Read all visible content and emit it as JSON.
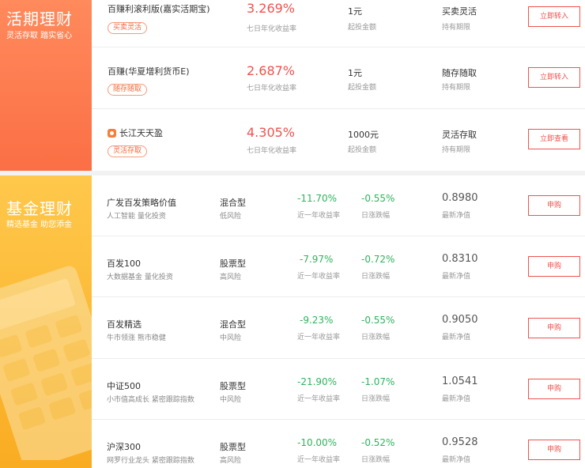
{
  "current_section": {
    "title": "活期理财",
    "subtitle": "灵活存取 踏实省心",
    "products": [
      {
        "name": "百赚利滚利版(嘉实活期宝)",
        "tag": "买卖灵活",
        "rate": "3.269%",
        "rate_label": "七日年化收益率",
        "min_amount": "1元",
        "min_label": "起投金额",
        "hold": "买卖灵活",
        "hold_label": "持有期限",
        "button": "立即转入"
      },
      {
        "name": "百赚(华夏增利货币E)",
        "tag": "随存随取",
        "rate": "2.687%",
        "rate_label": "七日年化收益率",
        "min_amount": "1元",
        "min_label": "起投金额",
        "hold": "随存随取",
        "hold_label": "持有期限",
        "button": "立即转入"
      },
      {
        "name": "长江天天盈",
        "tag": "灵活存取",
        "rate": "4.305%",
        "rate_label": "七日年化收益率",
        "min_amount": "1000元",
        "min_label": "起投金额",
        "hold": "灵活存取",
        "hold_label": "持有期限",
        "button": "立即查看"
      }
    ]
  },
  "fund_section": {
    "title": "基金理财",
    "subtitle": "精选基金 助您添金",
    "funds": [
      {
        "name": "广发百发策略价值",
        "desc": "人工智能  量化投资",
        "type": "混合型",
        "risk": "低风险",
        "year_return": "-11.70%",
        "year_label": "近一年收益率",
        "day_change": "-0.55%",
        "day_label": "日涨跌幅",
        "nav": "0.8980",
        "nav_label": "最新净值",
        "button": "申购"
      },
      {
        "name": "百发100",
        "desc": "大数据基金  量化投资",
        "type": "股票型",
        "risk": "高风险",
        "year_return": "-7.97%",
        "year_label": "近一年收益率",
        "day_change": "-0.72%",
        "day_label": "日涨跌幅",
        "nav": "0.8310",
        "nav_label": "最新净值",
        "button": "申购"
      },
      {
        "name": "百发精选",
        "desc": "牛市领涨  熊市稳健",
        "type": "混合型",
        "risk": "中风险",
        "year_return": "-9.23%",
        "year_label": "近一年收益率",
        "day_change": "-0.55%",
        "day_label": "日涨跌幅",
        "nav": "0.9050",
        "nav_label": "最新净值",
        "button": "申购"
      },
      {
        "name": "中证500",
        "desc": "小市值高成长  紧密跟踪指数",
        "type": "股票型",
        "risk": "中风险",
        "year_return": "-21.90%",
        "year_label": "近一年收益率",
        "day_change": "-1.07%",
        "day_label": "日涨跌幅",
        "nav": "1.0541",
        "nav_label": "最新净值",
        "button": "申购"
      },
      {
        "name": "沪深300",
        "desc": "网罗行业龙头  紧密跟踪指数",
        "type": "股票型",
        "risk": "高风险",
        "year_return": "-10.00%",
        "year_label": "近一年收益率",
        "day_change": "-0.52%",
        "day_label": "日涨跌幅",
        "nav": "0.9528",
        "nav_label": "最新净值",
        "button": "申购"
      }
    ]
  },
  "colors": {
    "accent_red": "#f0524d",
    "gain_green": "#2fb35c",
    "orange_panel": "#fb6f45",
    "yellow_panel": "#f9ac22"
  }
}
